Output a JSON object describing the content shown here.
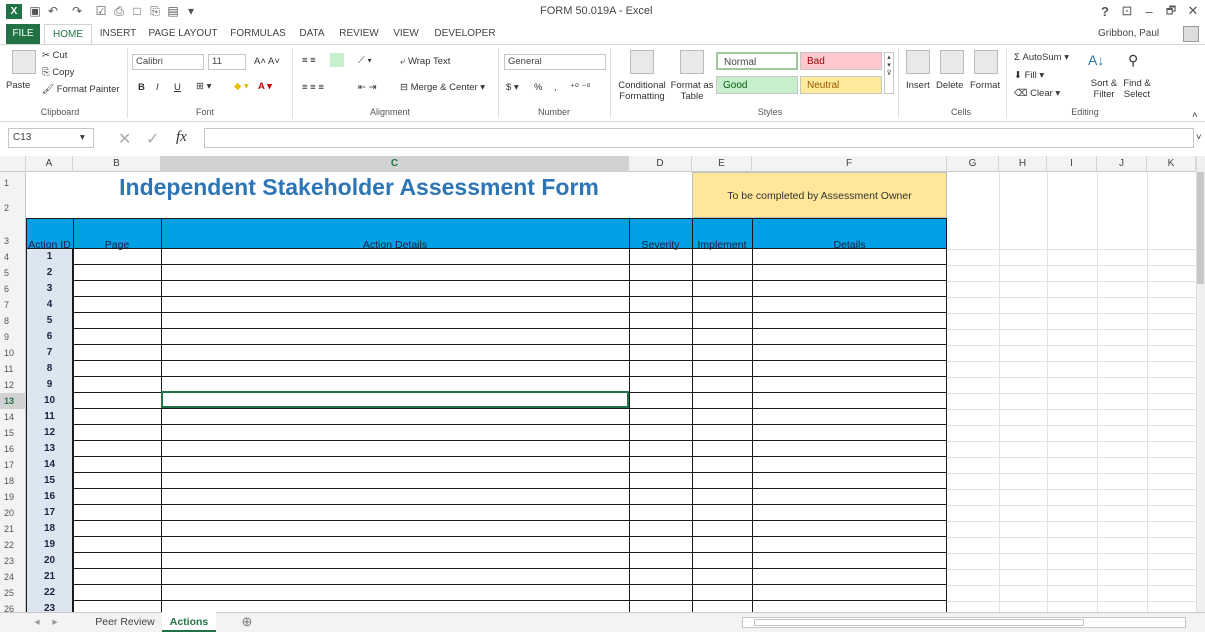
{
  "window": {
    "title": "FORM 50.019A - Excel",
    "user": "Gribbon, Paul",
    "help": "?",
    "minimize": "–",
    "restore": "🗗",
    "close": "✕"
  },
  "tabs": [
    "FILE",
    "HOME",
    "INSERT",
    "PAGE LAYOUT",
    "FORMULAS",
    "DATA",
    "REVIEW",
    "VIEW",
    "DEVELOPER"
  ],
  "clipboard": {
    "paste": "Paste",
    "cut": "Cut",
    "copy": "Copy",
    "painter": "Format Painter",
    "label": "Clipboard"
  },
  "font": {
    "name": "Calibri",
    "size": "11",
    "bold": "B",
    "italic": "I",
    "underline": "U",
    "label": "Font"
  },
  "alignment": {
    "wrap": "Wrap Text",
    "merge": "Merge & Center",
    "label": "Alignment"
  },
  "number": {
    "format": "General",
    "percent": "%",
    "comma": ",",
    "label": "Number"
  },
  "styles": {
    "conditional": "Conditional Formatting",
    "format_table": "Format as Table",
    "normal": "Normal",
    "bad": "Bad",
    "good": "Good",
    "neutral": "Neutral",
    "label": "Styles"
  },
  "cells": {
    "insert": "Insert",
    "delete": "Delete",
    "format": "Format",
    "label": "Cells"
  },
  "editing": {
    "autosum": "AutoSum",
    "fill": "Fill",
    "clear": "Clear",
    "sort": "Sort & Filter",
    "find": "Find & Select",
    "label": "Editing"
  },
  "formula_bar": {
    "name_box": "C13",
    "fx": "fx",
    "value": ""
  },
  "columns": [
    "A",
    "B",
    "C",
    "D",
    "E",
    "F",
    "G",
    "H",
    "I",
    "J",
    "K"
  ],
  "sheet": {
    "title": "Independent Stakeholder Assessment Form",
    "owner_note": "To be completed by Assessment Owner",
    "headers": [
      "Action ID",
      "Page",
      "Action Details",
      "Severity",
      "Implement",
      "Details"
    ],
    "row_numbers": [
      "1",
      "2",
      "3",
      "4",
      "5",
      "6",
      "7",
      "8",
      "9",
      "10",
      "11",
      "12",
      "13",
      "14",
      "15",
      "16",
      "17",
      "18",
      "19",
      "20",
      "21",
      "22",
      "23",
      "24",
      "25",
      "26"
    ],
    "action_ids": [
      "1",
      "2",
      "3",
      "4",
      "5",
      "6",
      "7",
      "8",
      "9",
      "10",
      "11",
      "12",
      "13",
      "14",
      "15",
      "16",
      "17",
      "18",
      "19",
      "20",
      "21",
      "22",
      "23"
    ]
  },
  "sheet_tabs": [
    "Peer Review",
    "Actions"
  ],
  "active_sheet": "Actions",
  "colors": {
    "accent": "#217346",
    "header_fill": "#00a0e4",
    "owner_fill": "#ffe699",
    "id_fill": "#dce6f1",
    "title_color": "#2e75b6"
  }
}
